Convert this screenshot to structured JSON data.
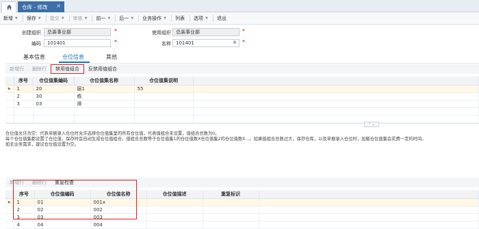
{
  "tabs": {
    "home_icon": "home-icon",
    "active_tab": "仓库 - 修改"
  },
  "toolbar": {
    "items": [
      {
        "label": "新增",
        "dropdown": true,
        "enabled": true
      },
      {
        "label": "保存",
        "dropdown": true,
        "enabled": true
      },
      {
        "label": "提交",
        "dropdown": true,
        "enabled": false
      },
      {
        "label": "审核",
        "dropdown": true,
        "enabled": false
      },
      {
        "label": "前一",
        "dropdown": true,
        "enabled": true
      },
      {
        "label": "后一",
        "dropdown": true,
        "enabled": true
      },
      {
        "label": "业务操作",
        "dropdown": true,
        "enabled": true
      },
      {
        "label": "列表",
        "dropdown": false,
        "enabled": true
      },
      {
        "label": "选项",
        "dropdown": true,
        "enabled": true
      },
      {
        "label": "退出",
        "dropdown": false,
        "enabled": true
      }
    ]
  },
  "form": {
    "create_org_label": "创建组织",
    "create_org_value": "总装事业部",
    "use_org_label": "使用组织",
    "use_org_value": "总装事业部",
    "code_label": "编码",
    "code_value": "101401",
    "name_label": "名称",
    "name_value": "101401",
    "required_mark": "*"
  },
  "subtabs": {
    "basic": "基本信息",
    "location": "仓位信息",
    "other": "其他"
  },
  "grid1": {
    "buttons": [
      "新增行",
      "删除行",
      "禁用值组合",
      "反禁用值组合"
    ],
    "headers": [
      "序号",
      "仓位值集编码",
      "仓位值集名称",
      "仓位值集说明"
    ],
    "rows": [
      {
        "seq": "1",
        "code": "20",
        "name": "层1",
        "desc": "55"
      },
      {
        "seq": "2",
        "code": "30",
        "name": "栋",
        "desc": ""
      },
      {
        "seq": "3",
        "code": "03",
        "name": "排",
        "desc": ""
      }
    ]
  },
  "description": {
    "line1": "仓位值允许为空：代表单据录入仓位时允许选择仓位值集里的所有仓位值，代表值组合未设置，值组合总数为0。",
    "line2": "每个仓位值集都设置了仓位值，保存时会自动生成仓位值组合，值组合总数等于仓位值集1的仓位值数X仓位值集2的仓位值数X...。如果值组合总数过大，保存仓库，以及单据录入仓位时，加载仓位值集会花费一定的时间。",
    "line3": "如无业务需求，建议仓位值设置为空。"
  },
  "grid2": {
    "buttons": [
      "新增行",
      "删除行",
      "重复检查"
    ],
    "headers": [
      "序号",
      "仓位值编码",
      "仓位值名称",
      "仓位值描述",
      "重复标识"
    ],
    "rows": [
      {
        "seq": "1",
        "code": "01",
        "name": "001x"
      },
      {
        "seq": "2",
        "code": "02",
        "name": "002"
      },
      {
        "seq": "3",
        "code": "03",
        "name": "003"
      },
      {
        "seq": "4",
        "code": "04",
        "name": "004"
      }
    ]
  },
  "colors": {
    "accent": "#1a73c9",
    "tab_active": "#3d6fa6",
    "highlight_box": "#e02020"
  }
}
